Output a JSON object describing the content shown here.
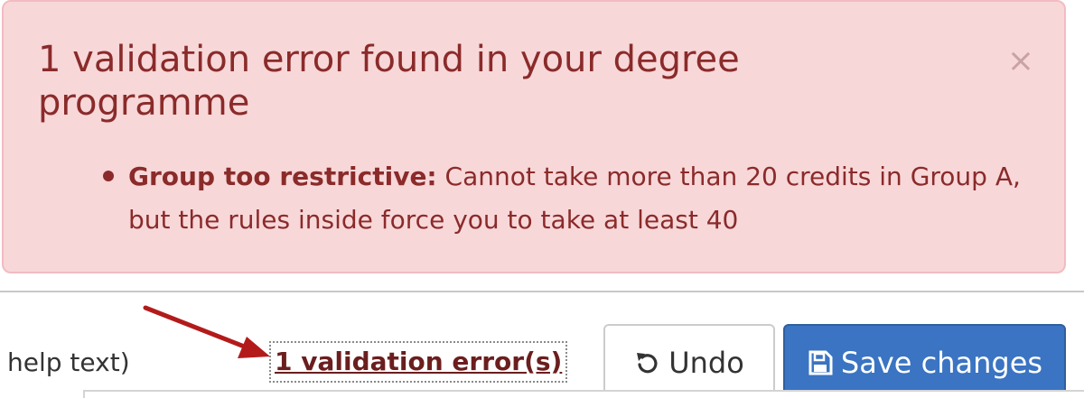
{
  "alert": {
    "title": "1 validation error found in your degree programme",
    "close_symbol": "×",
    "errors": [
      {
        "title": "Group too restrictive:",
        "message": "Cannot take more than 20 credits in Group A, but the rules inside force you to take at least 40"
      }
    ]
  },
  "toolbar": {
    "help_text": "help text)",
    "validation_link": "1 validation error(s)",
    "undo_label": "Undo",
    "save_label": "Save changes",
    "undo_icon": "undo-icon",
    "save_icon": "floppy-disk-icon"
  },
  "annotation": {
    "arrow_color": "#b31b1b"
  },
  "colors": {
    "alert_bg": "#f8d7d9",
    "alert_text": "#8a2b2a",
    "primary": "#3a74c2"
  }
}
